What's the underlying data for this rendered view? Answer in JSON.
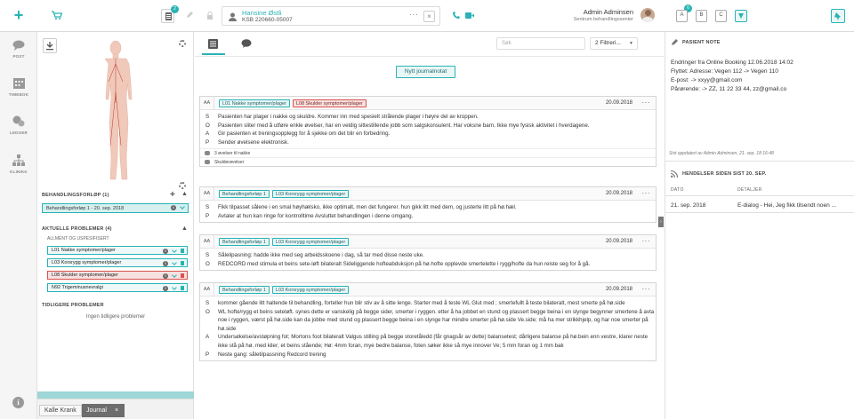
{
  "topbar": {
    "badge_count_tasks": "2",
    "patient_name": "Hansine Østli",
    "patient_id": "KSB 220660-05007",
    "user_name": "Admin Adminsen",
    "user_org": "Sentrum behandlingssenter",
    "letter_badge": "6",
    "letter_a": "A",
    "letter_b": "B",
    "letter_c": "C"
  },
  "leftnav": {
    "post": "POST",
    "timebok": "TIMEBOK",
    "ledger": "LEDGER",
    "klinikk": "KLINIKK"
  },
  "leftpanel": {
    "treatment_title": "BEHANDLINGSFORLØP (1)",
    "treatment_item": "Behandlingsforløp 1 - 20. sep. 2018",
    "active_title": "AKTUELLE PROBLEMER (4)",
    "general_title": "ALLMENT OG USPESIFISERT",
    "problems": [
      {
        "code": "L01",
        "label": "Nakke symptomer/plager"
      },
      {
        "code": "L03",
        "label": "Korsrygg symptomer/plager"
      },
      {
        "code": "L08",
        "label": "Skulder symptomer/plager"
      },
      {
        "code": "N92",
        "label": "Trigeminusnevralgi"
      }
    ],
    "previous_title": "TIDLIGERE PROBLEMER",
    "previous_empty": "Ingen tidligere problemer"
  },
  "center": {
    "search_placeholder": "Søk",
    "filter_label": "2 Filtreri...",
    "new_note_button": "Nytt journalnotat",
    "cards": [
      {
        "aa": "AA",
        "tags": [
          {
            "text": "L01 Nakke symptomer/plager"
          },
          {
            "text": "L08 Skulder symptomer/plager"
          }
        ],
        "date": "20.09.2018",
        "rows": [
          {
            "k": "S",
            "t": "Pasienten har plager i nakke og skuldre. Kommer inn med spesielt strålende plager i høyre del av kroppen."
          },
          {
            "k": "O",
            "t": "Pasienten sliter med å utføre enkle øvelser, har en veldig sittestillende jobb som salgskonsulent. Har voksne barn. Ikke mye fysisk aktivitet i hverdagene."
          },
          {
            "k": "A",
            "t": "Gir pasienten et treningsopplegg for å sjekke om det blir en forbedring."
          },
          {
            "k": "P",
            "t": "Sender øvelsene elektronisk."
          }
        ],
        "subrows": [
          "3 øvelser til nakke",
          "Skulderøvelser"
        ]
      },
      {
        "aa": "AA",
        "tags": [
          {
            "text": "Behandlingsforløp 1"
          },
          {
            "text": "L03 Korsrygg symptomer/plager"
          }
        ],
        "date": "20.09.2018",
        "rows": [
          {
            "k": "S",
            "t": "Fikk tilpasset sålene i en smal høyhælsko, ikke optimalt, men det fungerer. hun gikk litt med dem, og justerte litt på hø.hæl."
          },
          {
            "k": "P",
            "t": "Avtaler at hun kan ringe for kontrolltime Avsluttet behandlingen i denne omgang."
          }
        ]
      },
      {
        "aa": "AA",
        "tags": [
          {
            "text": "Behandlingsforløp 1"
          },
          {
            "text": "L03 Korsrygg symptomer/plager"
          }
        ],
        "date": "20.09.2018",
        "rows": [
          {
            "k": "S",
            "t": "Sålelipasning: hadde ikke med seg arbeidsskoene i dag, så tar med disse neste uke."
          },
          {
            "k": "O",
            "t": "REDCORD med stimula et beins sete-løft bilateralt Sideliggende hofteabduksjon på hø.hofte opplevde smertelette i rygg/hofte da hun reiste seg for å gå."
          }
        ]
      },
      {
        "aa": "AA",
        "tags": [
          {
            "text": "Behandlingsforløp 1"
          },
          {
            "text": "L03 Korsrygg symptomer/plager"
          }
        ],
        "date": "20.09.2018",
        "rows": [
          {
            "k": "S",
            "t": "kommer gående litt haltende til behandling, forteller hun blir stiv av å sitte lenge. Starter med å teste WL Glut med ; smertefullt å teste bilateralt, mest smerte på hø.side"
          },
          {
            "k": "O",
            "t": "WL hofte/rygg et beins seteløft. synes dette er vanskelig på begge sider, smerter i ryggen. etter å ha jobbet en stund og plassert begge beina i en slynge begynner smertene å avta noe i ryggen, værst på hø.side kan da jobbe med stund og plassert begge beina i en slynge har mindre smerter på hø.side Ve.side; må ha mer strikkhjelp, og har noe smerter på hø.side"
          },
          {
            "k": "A",
            "t": "Undersøkelse/avstøpning fot; Mortons foot bilateralt Valgus stilling på begge storetåledd (får gnagsår av dette) balansetest; dårligere balanse på hø.bein enn vestre, klarer neste ikke stå på hø. med kiler; et beins stående; Hø: 4mm foran, mye bedre balanse, foten søker ikke så mye innover Ve; 5 mm foran og 1 mm bak"
          },
          {
            "k": "P",
            "t": "Neste gang: såletilpassning Redcord trening"
          }
        ]
      }
    ]
  },
  "rightpanel": {
    "note_title": "PASIENT NOTE",
    "note_lines": [
      "Endringer fra Online Booking 12.06.2018 14:02",
      "Flyttet: Adresse: Vegen 112 -> Vegen 110",
      "E-post:  -> xxyy@gmail.com",
      "Pårørende:  -> ZZ, 11 22 33 44, zz@gmail.co"
    ],
    "updated_text": "Sist oppdatert av Admin Adminsen, 21. sep. 18 16:48",
    "events_title": "HENDELSER SIDEN SIST 20. SEP.",
    "col_date": "DATO",
    "col_details": "DETALJER",
    "event_date": "21. sep. 2018",
    "event_detail": "E-dialog - Hei, Jeg fikk tilsendt noen ..."
  },
  "bottombar": {
    "tab1": "Kalle Krank",
    "tab2": "Journal",
    "tab2_close": "×"
  },
  "colors": {
    "accent": "#2ab3b5",
    "problem_red": "#d9534f"
  }
}
